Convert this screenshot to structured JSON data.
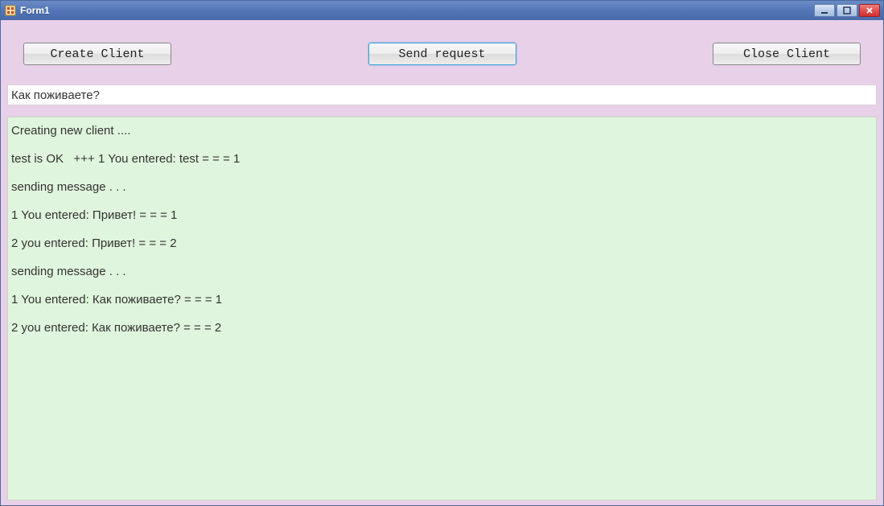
{
  "window": {
    "title": "Form1"
  },
  "buttons": {
    "create": "Create Client",
    "send": "Send request",
    "close": "Close Client"
  },
  "input": {
    "value": "Как поживаете?"
  },
  "log": {
    "lines": [
      "Creating new client ....",
      "test is OK   +++ 1 You entered: test = = = 1",
      "sending message . . .",
      "1 You entered: Привет! = = = 1",
      "2 you entered: Привет! = = = 2",
      "sending message . . .",
      "1 You entered: Как поживаете? = = = 1",
      "2 you entered: Как поживаете? = = = 2"
    ]
  }
}
